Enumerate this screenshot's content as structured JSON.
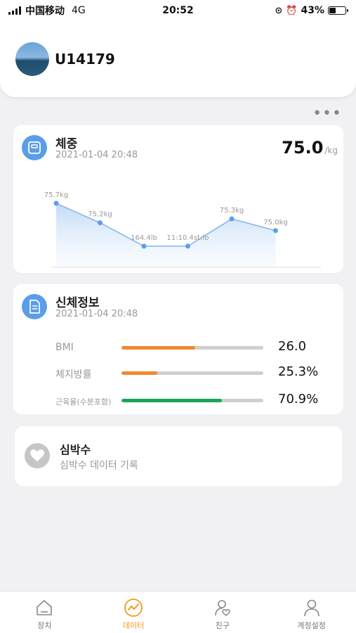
{
  "status_bar": {
    "carrier": "中国移动",
    "network": "4G",
    "time": "20:52",
    "battery": "43%",
    "battery_level": 0.43
  },
  "profile": {
    "username": "U14179"
  },
  "weight_card": {
    "title": "체중",
    "date": "2021-01-04 20:48",
    "value": "75.0",
    "unit": "/kg",
    "chart_data": {
      "type": "area",
      "points": [
        {
          "label": "75.7kg",
          "value": 75.7
        },
        {
          "label": "75.2kg",
          "value": 75.2
        },
        {
          "label": "164.4lb",
          "value": 74.6
        },
        {
          "label": "11:10.4st:lb",
          "value": 74.6
        },
        {
          "label": "75.3kg",
          "value": 75.3
        },
        {
          "label": "75.0kg",
          "value": 75.0
        }
      ]
    }
  },
  "body_card": {
    "title": "신체정보",
    "date": "2021-01-04 20:48",
    "metrics": [
      {
        "label": "BMI",
        "value": "26.0",
        "fraction": 0.52,
        "color": "#f08a2c"
      },
      {
        "label": "체지방률",
        "value": "25.3%",
        "fraction": 0.25,
        "color": "#f08a2c"
      },
      {
        "label": "근육율(수분포함)",
        "value": "70.9%",
        "fraction": 0.71,
        "color": "#1aa35a"
      }
    ]
  },
  "heart_card": {
    "title": "심박수",
    "subtitle": "심박수 데이터 기록"
  },
  "nav": {
    "items": [
      {
        "label": "장치",
        "icon": "home-icon"
      },
      {
        "label": "데이터",
        "icon": "data-icon",
        "active": true
      },
      {
        "label": "친구",
        "icon": "friends-icon"
      },
      {
        "label": "계정설정",
        "icon": "account-icon"
      }
    ],
    "active_color": "#f39a1e"
  },
  "colors": {
    "accent_blue": "#5a9eea",
    "line_blue": "#7fb4ea"
  }
}
